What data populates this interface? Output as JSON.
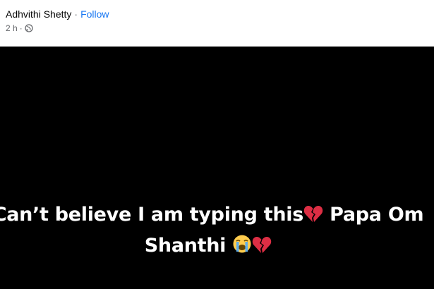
{
  "post": {
    "author": "Adhvithi Shetty",
    "separator": "·",
    "follow_label": "Follow",
    "time": "2 h",
    "time_separator": "·",
    "privacy_icon": "globe-icon",
    "text_line1": "Can’t believe I am typing this",
    "text_line1_emoji": "broken-heart-icon",
    "text_line1_cont": " Papa Om",
    "text_line2": "Shanthi ",
    "text_line2_emojis": [
      "crying-face-icon",
      "broken-heart-icon"
    ],
    "background_color": "#000000",
    "text_color": "#ffffff",
    "follow_color": "#1877f2"
  }
}
